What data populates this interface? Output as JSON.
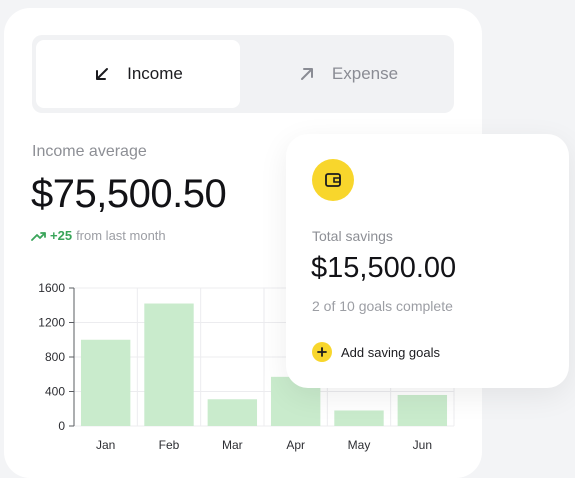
{
  "tabs": [
    {
      "label": "Income",
      "icon": "arrow-down-left-icon",
      "active": true
    },
    {
      "label": "Expense",
      "icon": "arrow-up-right-icon",
      "active": false
    }
  ],
  "summary": {
    "label": "Income average",
    "value": "$75,500.50",
    "trend_delta": "+25",
    "trend_text": "from last month",
    "trend_color": "#3aa55a"
  },
  "savings_card": {
    "icon": "wallet-icon",
    "label": "Total savings",
    "value": "$15,500.00",
    "subtitle": "2 of 10 goals complete",
    "action_label": "Add saving goals",
    "accent": "#f8d62c"
  },
  "chart_data": {
    "type": "bar",
    "categories": [
      "Jan",
      "Feb",
      "Mar",
      "Apr",
      "May",
      "Jun"
    ],
    "values": [
      1000,
      1420,
      310,
      570,
      180,
      360
    ],
    "yticks": [
      0,
      400,
      800,
      1200,
      1600
    ],
    "ylim": [
      0,
      1600
    ],
    "grid": true,
    "bar_color": "#c9ebcc"
  }
}
